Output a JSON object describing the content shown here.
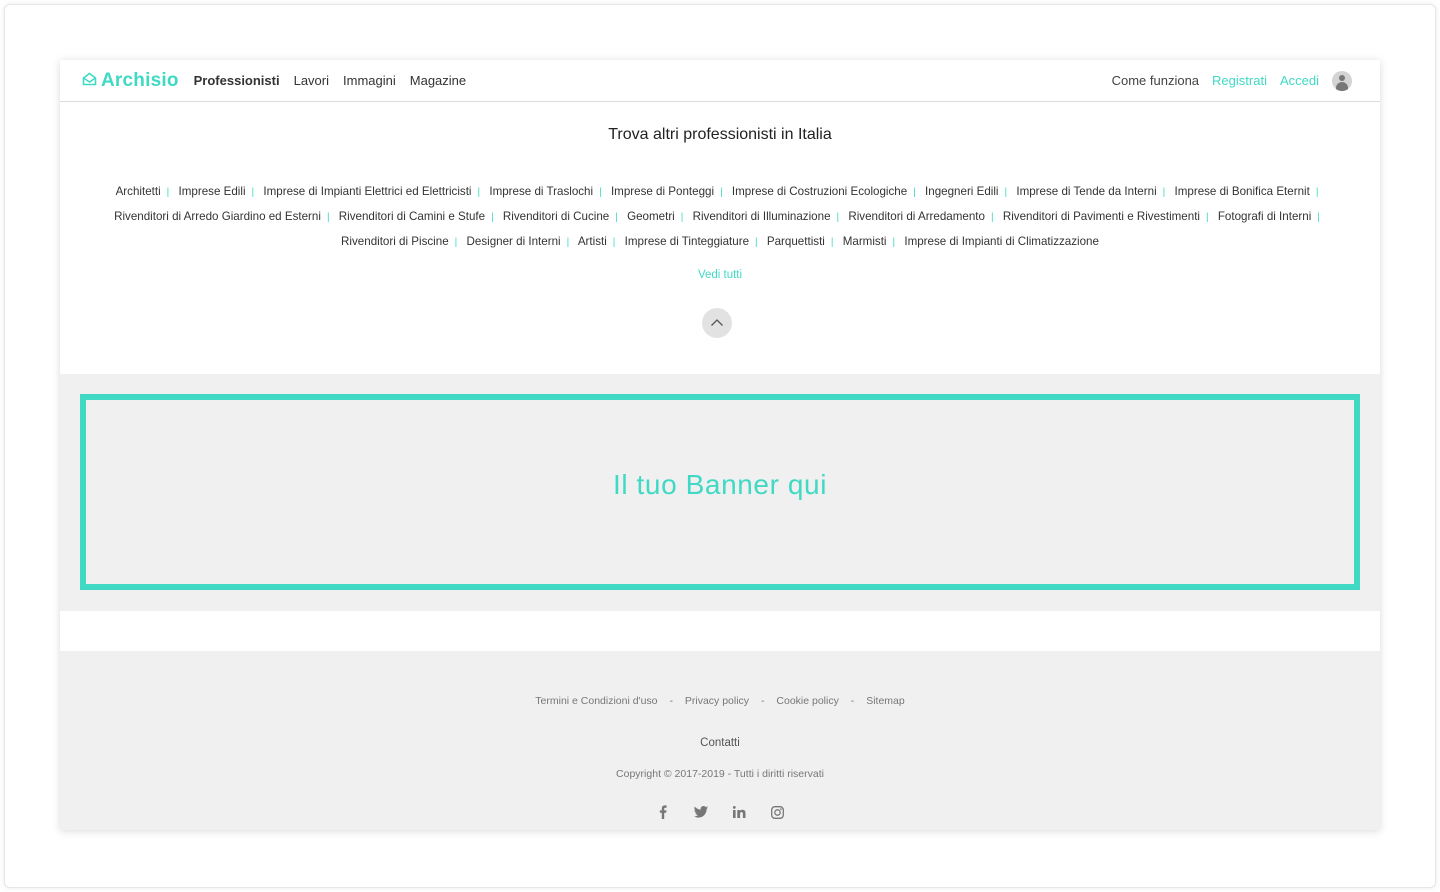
{
  "header": {
    "logo_text": "Archisio",
    "nav": [
      {
        "label": "Professionisti"
      },
      {
        "label": "Lavori"
      },
      {
        "label": "Immagini"
      },
      {
        "label": "Magazine"
      }
    ],
    "how_it_works": "Come funziona",
    "register": "Registrati",
    "login": "Accedi"
  },
  "find": {
    "title": "Trova altri professionisti in Italia",
    "categories": [
      "Architetti",
      "Imprese Edili",
      "Imprese di Impianti Elettrici ed Elettricisti",
      "Imprese di Traslochi",
      "Imprese di Ponteggi",
      "Imprese di Costruzioni Ecologiche",
      "Ingegneri Edili",
      "Imprese di Tende da Interni",
      "Imprese di Bonifica Eternit",
      "Rivenditori di Arredo Giardino ed Esterni",
      "Rivenditori di Camini e Stufe",
      "Rivenditori di Cucine",
      "Geometri",
      "Rivenditori di Illuminazione",
      "Rivenditori di Arredamento",
      "Rivenditori di Pavimenti e Rivestimenti",
      "Fotografi di Interni",
      "Rivenditori di Piscine",
      "Designer di Interni",
      "Artisti",
      "Imprese di Tinteggiature",
      "Parquettisti",
      "Marmisti",
      "Imprese di Impianti di Climatizzazione"
    ],
    "separator": "|",
    "see_all": "Vedi tutti"
  },
  "banner": {
    "text": "Il tuo Banner qui"
  },
  "footer": {
    "links": [
      {
        "label": "Termini e Condizioni d'uso"
      },
      {
        "label": "Privacy policy"
      },
      {
        "label": "Cookie policy"
      },
      {
        "label": "Sitemap"
      }
    ],
    "link_separator": "-",
    "contacts": "Contatti",
    "copyright": "Copyright © 2017-2019 - Tutti i diritti riservati",
    "socials": [
      "facebook-icon",
      "twitter-icon",
      "linkedin-icon",
      "instagram-icon"
    ]
  },
  "colors": {
    "accent": "#40d9c4",
    "band_background": "#f0f0f0"
  }
}
